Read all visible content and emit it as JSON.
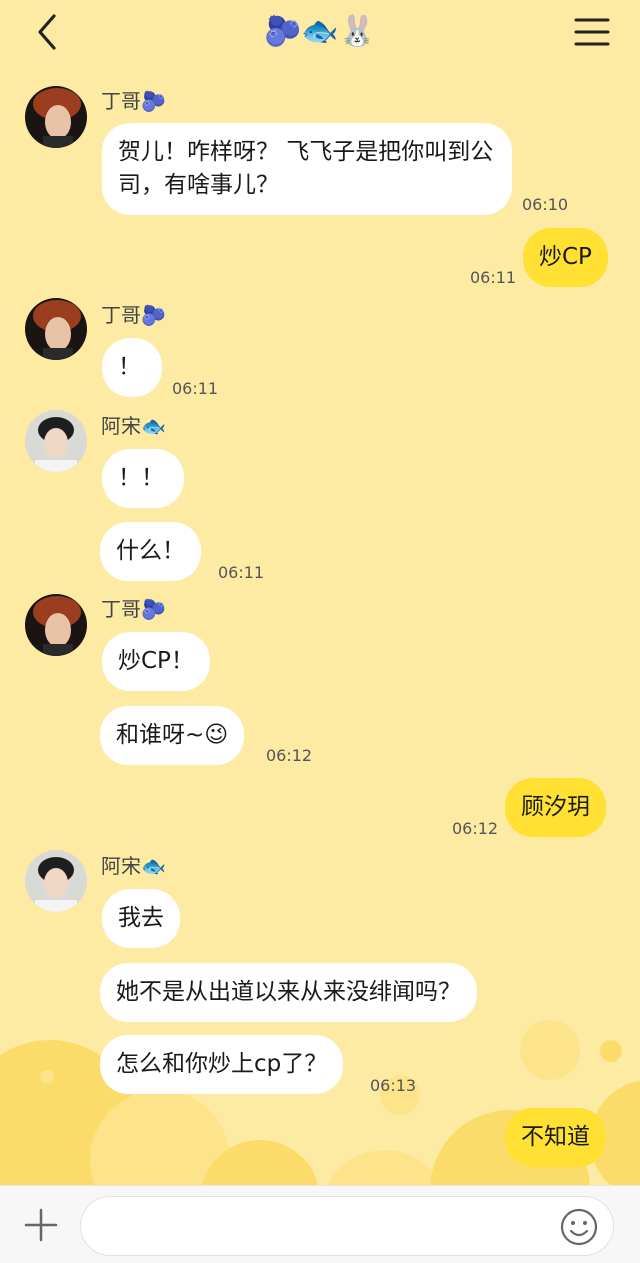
{
  "header": {
    "title": "🫐🐟🐰",
    "back_icon": "chevron-left-icon",
    "menu_icon": "hamburger-menu-icon"
  },
  "messages": [
    {
      "sender": "丁哥🫐",
      "text": "贺儿！咋样呀？ 飞飞子是把你叫到公司，有啥事儿？",
      "time": "06:10"
    },
    {
      "text": "炒CP",
      "time": "06:11",
      "mine": true
    },
    {
      "sender": "丁哥🫐",
      "text": "！",
      "time": "06:11"
    },
    {
      "sender": "阿宋🐟",
      "text": "！！"
    },
    {
      "text": "什么！",
      "time": "06:11"
    },
    {
      "sender": "丁哥🫐",
      "text": "炒CP！"
    },
    {
      "text": "和谁呀~😉",
      "time": "06:12"
    },
    {
      "text": "顾汐玥",
      "time": "06:12",
      "mine": true
    },
    {
      "sender": "阿宋🐟",
      "text": "我去"
    },
    {
      "text": "她不是从出道以来从来没绯闻吗？"
    },
    {
      "text": "怎么和你炒上cp了？",
      "time": "06:13"
    },
    {
      "text": "不知道",
      "mine": true
    }
  ],
  "input": {
    "value": "",
    "placeholder": "",
    "plus_icon": "plus-icon",
    "emoji_icon": "smiley-icon"
  },
  "colors": {
    "background": "#fdeba3",
    "my_bubble": "#ffe033",
    "other_bubble": "#ffffff"
  }
}
